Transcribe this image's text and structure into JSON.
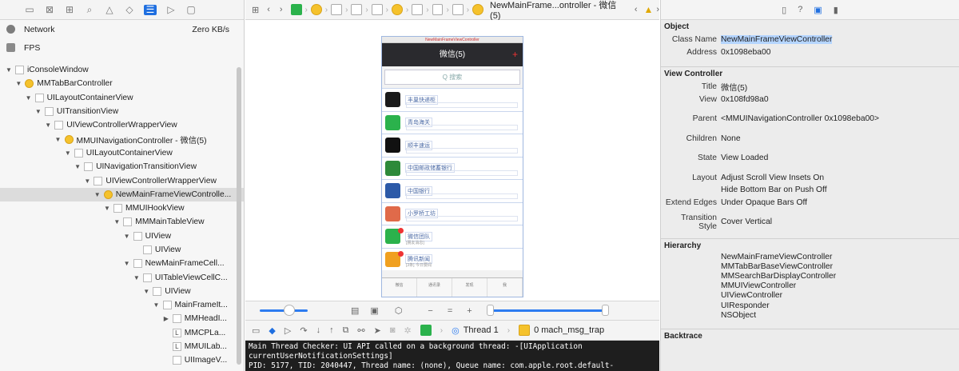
{
  "left": {
    "toolbar_icons": [
      "folder-icon",
      "x-square-icon",
      "hierarchy-icon",
      "search-icon",
      "warning-icon",
      "diamond-icon",
      "debug-navigator-icon",
      "tag-icon",
      "comment-icon"
    ],
    "network": {
      "label": "Network",
      "value": "Zero KB/s"
    },
    "fps": {
      "label": "FPS"
    },
    "tree": [
      {
        "label": "iConsoleWindow",
        "indent": 0,
        "box": "plain",
        "tri": "open"
      },
      {
        "label": "MMTabBarController",
        "indent": 1,
        "box": "yellow",
        "tri": "open"
      },
      {
        "label": "UILayoutContainerView",
        "indent": 2,
        "box": "plain",
        "tri": "open"
      },
      {
        "label": "UITransitionView",
        "indent": 3,
        "box": "plain",
        "tri": "open"
      },
      {
        "label": "UIViewControllerWrapperView",
        "indent": 4,
        "box": "plain",
        "tri": "open"
      },
      {
        "label": "MMUINavigationController - 微信(5)",
        "indent": 5,
        "box": "yellow",
        "tri": "open"
      },
      {
        "label": "UILayoutContainerView",
        "indent": 6,
        "box": "plain",
        "tri": "open"
      },
      {
        "label": "UINavigationTransitionView",
        "indent": 7,
        "box": "plain",
        "tri": "open"
      },
      {
        "label": "UIViewControllerWrapperView",
        "indent": 8,
        "box": "plain",
        "tri": "open"
      },
      {
        "label": "NewMainFrameViewControlle...",
        "indent": 9,
        "box": "yellow",
        "tri": "open",
        "selected": true
      },
      {
        "label": "MMUIHookView",
        "indent": 10,
        "box": "plain",
        "tri": "open"
      },
      {
        "label": "MMMainTableView",
        "indent": 11,
        "box": "plain",
        "tri": "open"
      },
      {
        "label": "UIView",
        "indent": 12,
        "box": "plain",
        "tri": "open"
      },
      {
        "label": "UIView",
        "indent": 13,
        "box": "plain",
        "tri": "none"
      },
      {
        "label": "NewMainFrameCell...",
        "indent": 12,
        "box": "plain",
        "tri": "open"
      },
      {
        "label": "UITableViewCellC...",
        "indent": 13,
        "box": "plain",
        "tri": "open"
      },
      {
        "label": "UIView",
        "indent": 14,
        "box": "plain",
        "tri": "open"
      },
      {
        "label": "MainFrameIt...",
        "indent": 15,
        "box": "plain",
        "tri": "open"
      },
      {
        "label": "MMHeadI...",
        "indent": 16,
        "box": "plain",
        "tri": "closed"
      },
      {
        "label": "MMCPLa...",
        "indent": 16,
        "box": "label",
        "tri": "none"
      },
      {
        "label": "MMUILab...",
        "indent": 16,
        "box": "label",
        "tri": "none"
      },
      {
        "label": "UIImageV...",
        "indent": 16,
        "box": "plain",
        "tri": "none"
      }
    ]
  },
  "center": {
    "breadcrumb_title": "NewMainFrame...ontroller - 微信(5)",
    "phone": {
      "top_label": "NewMainFrameViewController",
      "nav_title": "微信(5)",
      "search_placeholder": "Q 搜索",
      "cells": [
        {
          "title": "丰巢快递柜",
          "color": "#1a1a1a"
        },
        {
          "title": "青岛海关",
          "color": "#2bb24c"
        },
        {
          "title": "顺丰速运",
          "color": "#111111"
        },
        {
          "title": "中国邮政储蓄银行",
          "color": "#2d8a3a"
        },
        {
          "title": "中国银行",
          "color": "#2c5aa8"
        },
        {
          "title": "小罗桥工坊",
          "color": "#e06a4a"
        },
        {
          "title": "微信团队",
          "subtitle": "[朋友消息]",
          "color": "#2bb24c",
          "badge": true
        },
        {
          "title": "腾讯新闻",
          "subtitle": "[3条] 今日要闻",
          "color": "#f0a020",
          "badge": true
        }
      ],
      "tabs": [
        "微信",
        "通讯录",
        "发现",
        "我"
      ]
    },
    "thread_label": "Thread 1",
    "frame_label": "0 mach_msg_trap",
    "console_lines": [
      "Main Thread Checker: UI API called on a background thread: -[UIApplication",
      "currentUserNotificationSettings]",
      "PID: 5177, TID: 2040447, Thread name: (none), Queue name: com.apple.root.default-"
    ]
  },
  "right": {
    "sections": {
      "object": "Object",
      "view_controller": "View Controller",
      "hierarchy": "Hierarchy",
      "backtrace": "Backtrace"
    },
    "object": [
      {
        "key": "Class Name",
        "value": "NewMainFrameViewController",
        "highlight": true
      },
      {
        "key": "Address",
        "value": "0x1098eba00"
      }
    ],
    "vc": [
      {
        "key": "Title",
        "value": "微信(5)"
      },
      {
        "key": "View",
        "value": "0x108fd98a0"
      },
      {
        "key": "",
        "value": ""
      },
      {
        "key": "Parent",
        "value": "<MMUINavigationController 0x1098eba00>"
      },
      {
        "key": "",
        "value": ""
      },
      {
        "key": "Children",
        "value": "None"
      },
      {
        "key": "",
        "value": ""
      },
      {
        "key": "State",
        "value": "View Loaded"
      },
      {
        "key": "",
        "value": ""
      },
      {
        "key": "Layout",
        "value": "Adjust Scroll View Insets On"
      },
      {
        "key": "",
        "value": "Hide Bottom Bar on Push Off"
      },
      {
        "key": "Extend Edges",
        "value": "Under Opaque Bars Off"
      },
      {
        "key": "",
        "value": ""
      },
      {
        "key": "Transition Style",
        "value": "Cover Vertical"
      }
    ],
    "hierarchy": [
      "NewMainFrameViewController",
      "MMTabBarBaseViewController",
      "MMSearchBarDisplayController",
      "MMUIViewController",
      "UIViewController",
      "UIResponder",
      "NSObject"
    ]
  }
}
